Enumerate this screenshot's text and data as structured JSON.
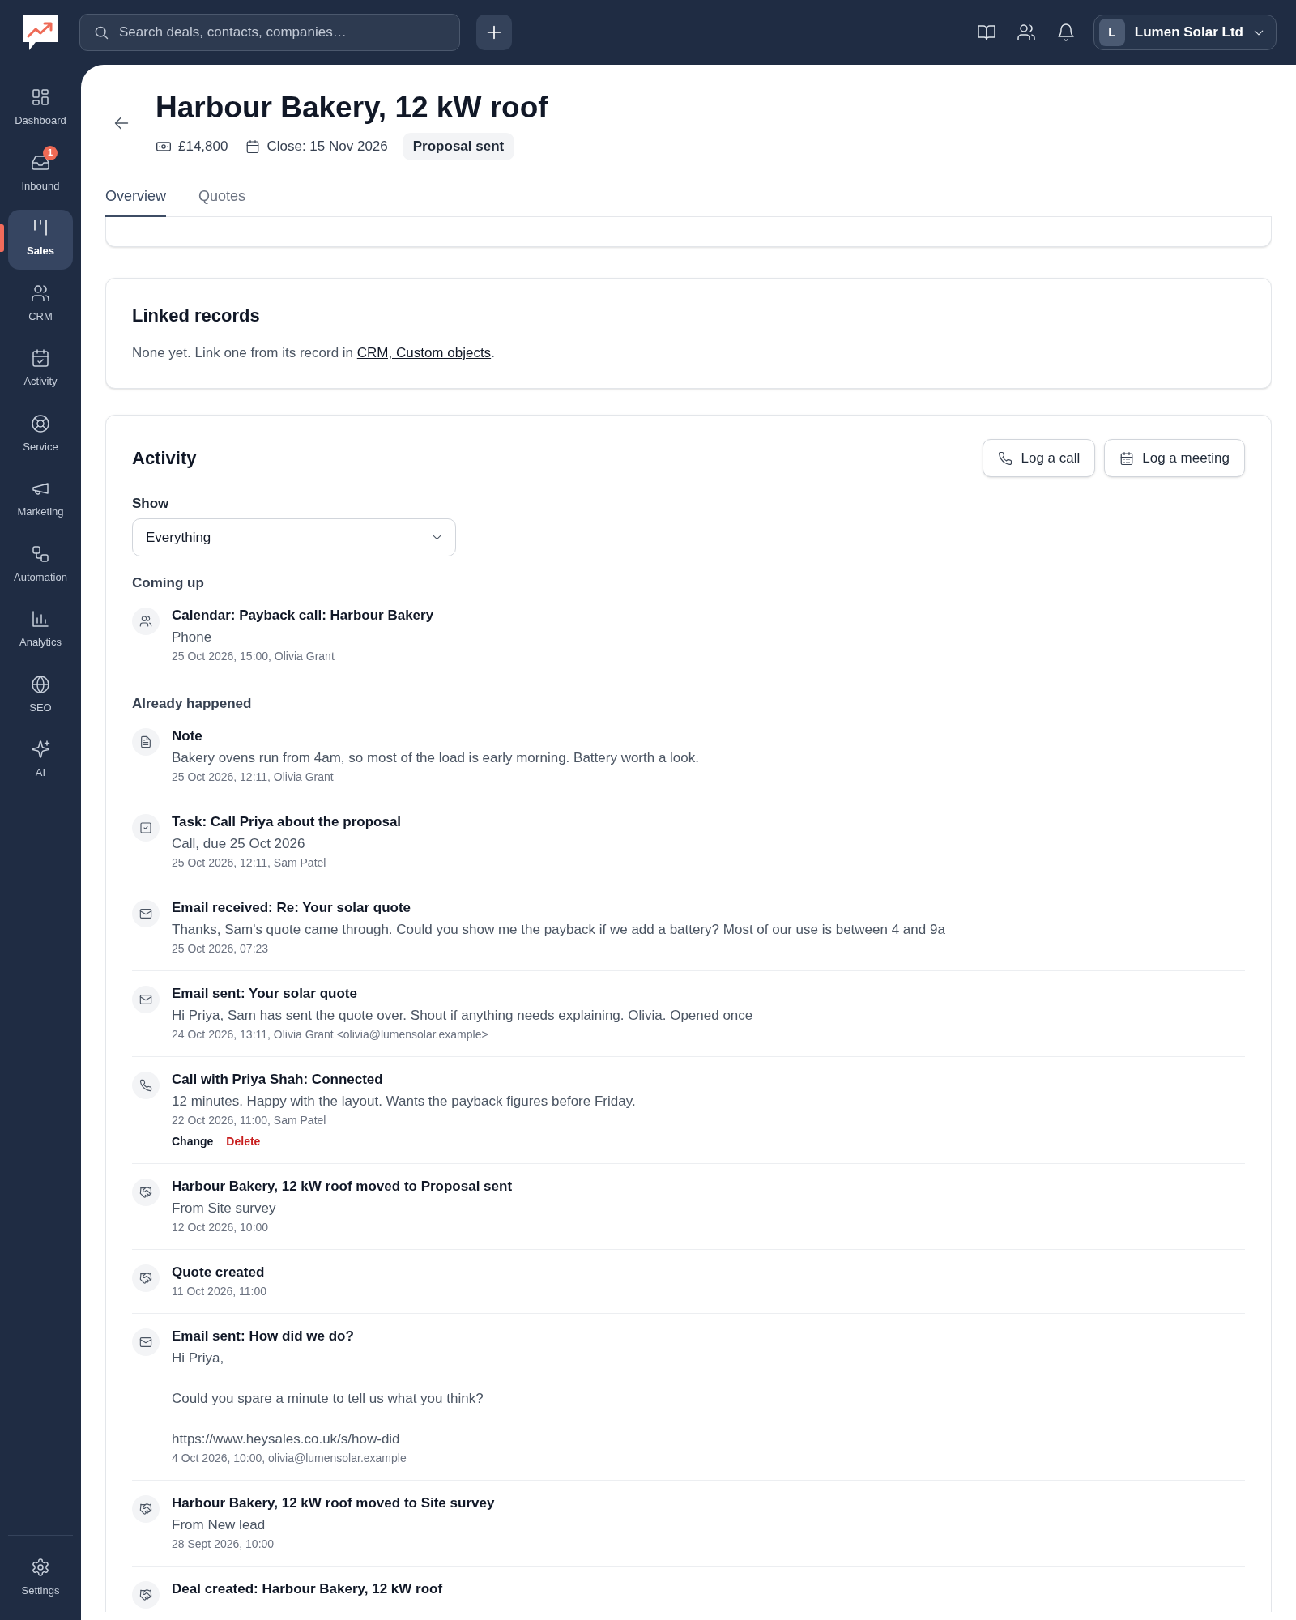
{
  "top_bar": {
    "search": {
      "placeholder": "Search deals, contacts, companies…"
    },
    "account": {
      "initial": "L",
      "name": "Lumen Solar Ltd"
    }
  },
  "sidebar": {
    "items": [
      {
        "label": "Dashboard",
        "selected": false
      },
      {
        "label": "Inbound",
        "badge": "1",
        "selected": false
      },
      {
        "label": "Sales",
        "selected": true
      },
      {
        "label": "CRM",
        "selected": false
      },
      {
        "label": "Activity",
        "selected": false
      },
      {
        "label": "Service",
        "selected": false
      },
      {
        "label": "Marketing",
        "selected": false
      },
      {
        "label": "Automation",
        "selected": false
      },
      {
        "label": "Analytics",
        "selected": false
      },
      {
        "label": "SEO",
        "selected": false
      },
      {
        "label": "AI",
        "selected": false
      }
    ],
    "footer_items": [
      {
        "label": "Settings",
        "selected": false
      }
    ]
  },
  "deal": {
    "title": "Harbour Bakery, 12 kW roof",
    "amount": "£14,800",
    "close_date": "Close: 15 Nov 2026",
    "stage": "Proposal sent"
  },
  "tabs": [
    {
      "label": "Overview",
      "selected": true
    },
    {
      "label": "Quotes",
      "selected": false
    }
  ],
  "linked_records": {
    "title": "Linked records",
    "text": "None yet. Link one from its record in ",
    "link": "CRM, Custom objects",
    "text_after": "."
  },
  "activity": {
    "title": "Activity",
    "buttons": [
      {
        "label": "Log a call",
        "kind": "call"
      },
      {
        "label": "Log a meeting",
        "kind": "meeting"
      }
    ],
    "filter": {
      "label": "Show",
      "value": "Everything"
    },
    "groups": [
      {
        "heading": "Coming up",
        "items": [
          {
            "kind": "meeting",
            "title": "Calendar: Payback call: Harbour Bakery",
            "body": [
              "Phone"
            ],
            "meta": "25 Oct 2026, 15:00, Olivia Grant"
          }
        ]
      },
      {
        "heading": "Already happened",
        "items": [
          {
            "kind": "note",
            "title": "Note",
            "body": [
              "Bakery ovens run from 4am, so most of the load is early morning. Battery worth a look."
            ],
            "meta": "25 Oct 2026, 12:11, Olivia Grant"
          },
          {
            "kind": "task",
            "title": "Task: Call Priya about the proposal",
            "body": [
              "Call, due 25 Oct 2026"
            ],
            "meta": "25 Oct 2026, 12:11, Sam Patel"
          },
          {
            "kind": "email",
            "title": "Email received: Re: Your solar quote",
            "body": [
              "Thanks, Sam's quote came through. Could you show me the payback if we add a battery? Most of our use is between 4 and 9a"
            ],
            "meta": "25 Oct 2026, 07:23"
          },
          {
            "kind": "email",
            "title": "Email sent: Your solar quote",
            "body": [
              "Hi Priya, Sam has sent the quote over. Shout if anything needs explaining. Olivia. Opened once"
            ],
            "meta": "24 Oct 2026, 13:11, Olivia Grant <olivia@lumensolar.example>"
          },
          {
            "kind": "call",
            "title": "Call with Priya Shah: Connected",
            "body": [
              "12 minutes. Happy with the layout. Wants the payback figures before Friday."
            ],
            "meta": "22 Oct 2026, 11:00, Sam Patel",
            "actions": [
              {
                "label": "Change",
                "kind": "edit"
              },
              {
                "label": "Delete",
                "kind": "delete"
              }
            ]
          },
          {
            "kind": "stage",
            "title": "Harbour Bakery, 12 kW roof moved to Proposal sent",
            "body": [
              "From Site survey"
            ],
            "meta": "12 Oct 2026, 10:00"
          },
          {
            "kind": "stage",
            "title": "Quote created",
            "meta": "11 Oct 2026, 11:00"
          },
          {
            "kind": "email",
            "title": "Email sent: How did we do?",
            "body": [
              "Hi Priya,",
              "Could you spare a minute to tell us what you think?",
              "https://www.heysales.co.uk/s/how-did"
            ],
            "meta": "4 Oct 2026, 10:00, olivia@lumensolar.example"
          },
          {
            "kind": "stage",
            "title": "Harbour Bakery, 12 kW roof moved to Site survey",
            "body": [
              "From New lead"
            ],
            "meta": "28 Sept 2026, 10:00"
          },
          {
            "kind": "stage",
            "title": "Deal created: Harbour Bakery, 12 kW roof"
          }
        ]
      }
    ]
  }
}
